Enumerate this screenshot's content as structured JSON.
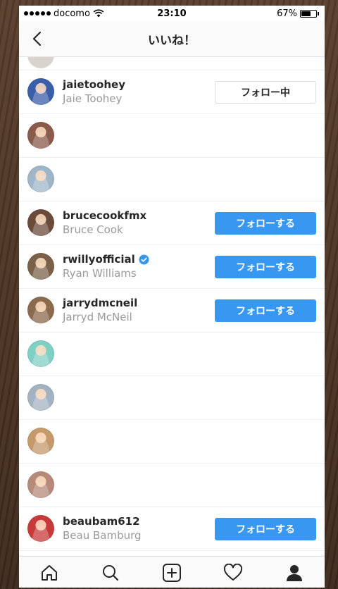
{
  "status_bar": {
    "carrier": "docomo",
    "time": "23:10",
    "battery": "67%",
    "battery_level": 0.67
  },
  "header": {
    "title": "いいね！",
    "back_icon": "chevron-left-icon"
  },
  "likers": [
    {
      "username": "jaietoohey",
      "full_name": "Jaie Toohey",
      "button": "フォロー中",
      "button_state": "following",
      "avatar_color": "#3a5ea8"
    },
    {
      "username": "",
      "full_name": "",
      "button": "",
      "button_state": "none",
      "avatar_color": "#8a5a4a"
    },
    {
      "username": "",
      "full_name": "",
      "button": "",
      "button_state": "none",
      "avatar_color": "#9fb5c8"
    },
    {
      "username": "brucecookfmx",
      "full_name": "Bruce Cook",
      "button": "フォローする",
      "button_state": "follow",
      "avatar_color": "#6b4a3a"
    },
    {
      "username": "rwillyofficial",
      "full_name": "Ryan Williams",
      "button": "フォローする",
      "button_state": "follow",
      "verified": true,
      "avatar_color": "#7a6048"
    },
    {
      "username": "jarrydmcneil",
      "full_name": "Jarryd McNeil",
      "button": "フォローする",
      "button_state": "follow",
      "avatar_color": "#8c6a4e"
    },
    {
      "username": "",
      "full_name": "",
      "button": "",
      "button_state": "none",
      "avatar_color": "#7fcfc4"
    },
    {
      "username": "",
      "full_name": "",
      "button": "",
      "button_state": "none",
      "avatar_color": "#a3b2c0"
    },
    {
      "username": "",
      "full_name": "",
      "button": "",
      "button_state": "none",
      "avatar_color": "#c49a6a"
    },
    {
      "username": "",
      "full_name": "",
      "button": "",
      "button_state": "none",
      "avatar_color": "#b58a7a"
    },
    {
      "username": "beaubam612",
      "full_name": "Beau Bamburg",
      "button": "フォローする",
      "button_state": "follow",
      "avatar_color": "#c83a3a"
    }
  ],
  "tabbar": {
    "items": [
      {
        "icon": "home-icon"
      },
      {
        "icon": "search-icon"
      },
      {
        "icon": "add-post-icon"
      },
      {
        "icon": "heart-icon"
      },
      {
        "icon": "profile-icon",
        "active": true
      }
    ]
  },
  "colors": {
    "follow_button": "#3897f0",
    "verified_badge": "#3897f0"
  }
}
